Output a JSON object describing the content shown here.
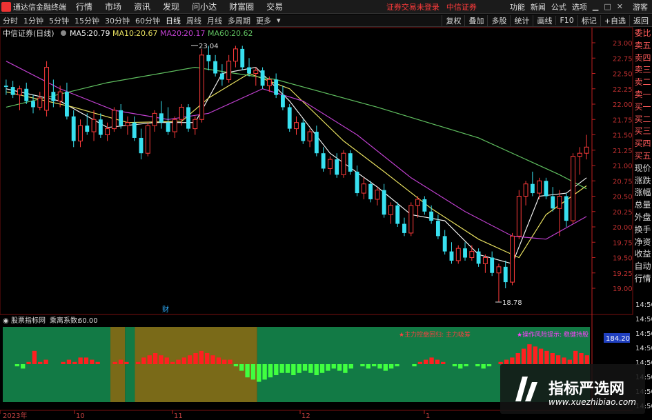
{
  "menubar": {
    "app_title": "通达信金融终端",
    "items": [
      "行情",
      "市场",
      "资讯",
      "发现",
      "问小达",
      "财富圈",
      "交易"
    ],
    "notice_left": "证券交易未登录",
    "notice_right": "中信证券",
    "right_items": [
      "功能",
      "新闻",
      "公式",
      "选项"
    ],
    "guest": "游客"
  },
  "toolbar": {
    "periods": [
      "分时",
      "1分钟",
      "5分钟",
      "15分钟",
      "30分钟",
      "60分钟",
      "日线",
      "周线",
      "月线",
      "多周期",
      "更多"
    ],
    "right_buttons": [
      "复权",
      "叠加",
      "多股",
      "统计",
      "画线",
      "F10",
      "标记",
      "+自选",
      "返回"
    ]
  },
  "chart_header": {
    "stock": "中信证券(日线)",
    "ma5_label": "MA5:",
    "ma5": "20.79",
    "ma10_label": "MA10:",
    "ma10": "20.67",
    "ma20_label": "MA20:",
    "ma20": "20.17",
    "ma60_label": "MA60:",
    "ma60": "20.62"
  },
  "colors": {
    "up": "#ff3b3b",
    "down": "#38e0f0",
    "ma5": "#f0f0f0",
    "ma10": "#e8e060",
    "ma20": "#c040d0",
    "ma60": "#60c060",
    "axis": "#c02020"
  },
  "price_axis": [
    "23.00",
    "22.75",
    "22.50",
    "22.25",
    "22.00",
    "21.75",
    "21.50",
    "21.25",
    "21.00",
    "20.75",
    "20.50",
    "20.25",
    "20.00",
    "19.75",
    "19.50",
    "19.25",
    "19.00"
  ],
  "high_annot": "23.04",
  "low_annot": "18.78",
  "news_marker": "财",
  "indicator_header": {
    "name": "股票指标网",
    "coef_label": "乘离系数:",
    "coef": "60.00"
  },
  "indicator_tags": {
    "left": "★主力控盘回归: 主力吸筹",
    "right": "★操作风险提示: 稳健持股"
  },
  "indicator_value": "184.20",
  "side_tabs": [
    "委比",
    "卖五",
    "卖四",
    "卖三",
    "卖二",
    "卖一",
    "买一",
    "买二",
    "买三",
    "买四",
    "买五",
    "现价",
    "涨跌",
    "涨幅",
    "总量",
    "外盘",
    "换手",
    "净资",
    "收益",
    "自动",
    "行情"
  ],
  "side_times": [
    "14:50",
    "14:50",
    "14:50",
    "14:50",
    "14:50",
    "14:50",
    "14:50",
    "14:50"
  ],
  "date_axis": {
    "y2023": "2023年",
    "m10": "10",
    "m11": "11",
    "m12": "12",
    "m1": "1"
  },
  "watermark": {
    "cn": "指标严选网",
    "en": "www.xuezhibiao.com"
  },
  "chart_data": {
    "type": "candlestick",
    "ylim": [
      18.78,
      23.04
    ],
    "ohlc": [
      [
        22.3,
        22.4,
        22.15,
        22.28
      ],
      [
        22.28,
        22.38,
        22.1,
        22.15
      ],
      [
        22.15,
        22.3,
        21.9,
        22.25
      ],
      [
        22.25,
        22.35,
        22.0,
        22.05
      ],
      [
        22.05,
        22.15,
        21.85,
        21.95
      ],
      [
        21.95,
        22.2,
        21.9,
        22.1
      ],
      [
        21.9,
        22.7,
        21.8,
        22.6
      ],
      [
        22.2,
        22.4,
        21.95,
        22.05
      ],
      [
        22.05,
        22.3,
        21.95,
        22.2
      ],
      [
        22.2,
        22.35,
        21.75,
        21.8
      ],
      [
        21.8,
        21.9,
        21.3,
        21.4
      ],
      [
        21.4,
        21.75,
        21.3,
        21.65
      ],
      [
        21.65,
        21.85,
        21.5,
        21.55
      ],
      [
        21.55,
        21.9,
        21.4,
        21.75
      ],
      [
        21.75,
        21.85,
        21.45,
        21.5
      ],
      [
        21.5,
        21.7,
        21.4,
        21.6
      ],
      [
        21.6,
        21.95,
        21.55,
        21.9
      ],
      [
        21.9,
        22.0,
        21.6,
        21.65
      ],
      [
        21.65,
        21.8,
        21.5,
        21.7
      ],
      [
        21.7,
        21.8,
        21.4,
        21.45
      ],
      [
        21.45,
        21.6,
        21.1,
        21.2
      ],
      [
        21.2,
        21.7,
        21.15,
        21.65
      ],
      [
        21.65,
        21.9,
        21.55,
        21.85
      ],
      [
        21.85,
        22.05,
        21.6,
        21.7
      ],
      [
        21.7,
        21.95,
        21.5,
        21.55
      ],
      [
        21.55,
        21.8,
        21.45,
        21.75
      ],
      [
        21.75,
        22.0,
        21.65,
        21.95
      ],
      [
        21.95,
        22.0,
        21.55,
        21.6
      ],
      [
        21.6,
        21.8,
        21.5,
        21.75
      ],
      [
        21.75,
        22.9,
        21.7,
        22.8
      ],
      [
        22.8,
        22.95,
        22.55,
        22.7
      ],
      [
        22.7,
        22.8,
        22.45,
        22.5
      ],
      [
        22.5,
        22.65,
        22.3,
        22.4
      ],
      [
        22.4,
        22.8,
        22.35,
        22.7
      ],
      [
        22.7,
        22.95,
        22.6,
        22.9
      ],
      [
        22.9,
        22.95,
        22.55,
        22.6
      ],
      [
        22.6,
        22.75,
        22.45,
        22.5
      ],
      [
        22.5,
        22.6,
        22.3,
        22.55
      ],
      [
        22.55,
        22.6,
        22.25,
        22.3
      ],
      [
        22.3,
        22.45,
        22.2,
        22.4
      ],
      [
        22.4,
        22.5,
        22.1,
        22.15
      ],
      [
        22.15,
        22.3,
        21.9,
        21.95
      ],
      [
        21.95,
        22.0,
        21.55,
        21.6
      ],
      [
        21.6,
        21.8,
        21.5,
        21.7
      ],
      [
        21.7,
        21.75,
        21.35,
        21.4
      ],
      [
        21.4,
        21.6,
        21.3,
        21.55
      ],
      [
        21.55,
        21.65,
        21.15,
        21.2
      ],
      [
        21.2,
        21.3,
        20.9,
        20.95
      ],
      [
        20.95,
        21.15,
        20.85,
        21.1
      ],
      [
        21.1,
        21.2,
        20.8,
        20.85
      ],
      [
        20.85,
        21.25,
        20.8,
        21.2
      ],
      [
        21.2,
        21.25,
        20.85,
        20.9
      ],
      [
        20.9,
        21.0,
        20.5,
        20.55
      ],
      [
        20.55,
        20.8,
        20.45,
        20.7
      ],
      [
        20.7,
        20.75,
        20.4,
        20.45
      ],
      [
        20.45,
        20.65,
        20.35,
        20.6
      ],
      [
        20.6,
        20.7,
        20.15,
        20.2
      ],
      [
        20.2,
        20.4,
        20.05,
        20.35
      ],
      [
        20.35,
        20.4,
        20.0,
        20.05
      ],
      [
        20.05,
        20.15,
        19.85,
        19.9
      ],
      [
        19.9,
        20.4,
        19.85,
        20.35
      ],
      [
        20.35,
        20.5,
        20.15,
        20.45
      ],
      [
        20.45,
        20.5,
        20.2,
        20.25
      ],
      [
        20.25,
        20.35,
        20.05,
        20.1
      ],
      [
        20.1,
        20.2,
        19.8,
        19.85
      ],
      [
        19.85,
        19.95,
        19.55,
        19.6
      ],
      [
        19.6,
        19.75,
        19.4,
        19.45
      ],
      [
        19.45,
        19.7,
        19.4,
        19.65
      ],
      [
        19.65,
        19.75,
        19.45,
        19.5
      ],
      [
        19.5,
        19.7,
        19.45,
        19.6
      ],
      [
        19.6,
        19.65,
        19.35,
        19.4
      ],
      [
        19.4,
        19.55,
        19.25,
        19.5
      ],
      [
        19.5,
        19.6,
        19.2,
        19.25
      ],
      [
        19.25,
        19.4,
        18.78,
        19.35
      ],
      [
        19.35,
        19.45,
        19.0,
        19.1
      ],
      [
        19.1,
        19.9,
        19.05,
        19.85
      ],
      [
        19.85,
        20.6,
        19.8,
        20.5
      ],
      [
        20.5,
        20.75,
        20.35,
        20.7
      ],
      [
        20.7,
        20.9,
        20.5,
        20.55
      ],
      [
        20.55,
        20.8,
        20.45,
        20.75
      ],
      [
        20.75,
        20.8,
        20.45,
        20.5
      ],
      [
        20.5,
        20.65,
        20.25,
        20.3
      ],
      [
        20.3,
        20.6,
        19.85,
        20.5
      ],
      [
        20.5,
        20.55,
        20.0,
        20.1
      ],
      [
        20.1,
        21.2,
        20.05,
        21.15
      ],
      [
        21.15,
        21.3,
        20.85,
        21.2
      ],
      [
        21.2,
        21.5,
        21.1,
        21.3
      ]
    ],
    "ma_series": [
      {
        "name": "MA5",
        "start": 22.25,
        "path": [
          [
            0,
            22.25
          ],
          [
            8,
            22.05
          ],
          [
            15,
            21.62
          ],
          [
            22,
            21.7
          ],
          [
            28,
            21.7
          ],
          [
            32,
            22.5
          ],
          [
            37,
            22.6
          ],
          [
            42,
            22.05
          ],
          [
            48,
            21.2
          ],
          [
            55,
            20.65
          ],
          [
            60,
            20.2
          ],
          [
            65,
            20.1
          ],
          [
            70,
            19.55
          ],
          [
            75,
            19.4
          ],
          [
            79,
            20.5
          ],
          [
            83,
            20.55
          ],
          [
            86,
            20.8
          ]
        ]
      },
      {
        "name": "MA10",
        "start": 22.2,
        "path": [
          [
            0,
            22.2
          ],
          [
            10,
            21.95
          ],
          [
            18,
            21.7
          ],
          [
            26,
            21.72
          ],
          [
            30,
            22.1
          ],
          [
            36,
            22.5
          ],
          [
            42,
            22.25
          ],
          [
            50,
            21.4
          ],
          [
            56,
            20.9
          ],
          [
            63,
            20.3
          ],
          [
            70,
            19.8
          ],
          [
            76,
            19.5
          ],
          [
            80,
            20.2
          ],
          [
            86,
            20.67
          ]
        ]
      },
      {
        "name": "MA20",
        "start": 22.7,
        "path": [
          [
            0,
            22.7
          ],
          [
            8,
            22.25
          ],
          [
            16,
            21.9
          ],
          [
            24,
            21.75
          ],
          [
            30,
            21.85
          ],
          [
            38,
            22.25
          ],
          [
            44,
            22.05
          ],
          [
            52,
            21.5
          ],
          [
            60,
            20.8
          ],
          [
            68,
            20.25
          ],
          [
            75,
            19.85
          ],
          [
            80,
            19.8
          ],
          [
            86,
            20.17
          ]
        ]
      },
      {
        "name": "MA60",
        "start": 21.95,
        "path": [
          [
            0,
            21.95
          ],
          [
            15,
            22.35
          ],
          [
            28,
            22.6
          ],
          [
            40,
            22.4
          ],
          [
            55,
            21.95
          ],
          [
            70,
            21.45
          ],
          [
            82,
            20.85
          ],
          [
            86,
            20.62
          ]
        ]
      }
    ],
    "indicator": {
      "bands": [
        [
          "green",
          0,
          22
        ],
        [
          "olive",
          22,
          25
        ],
        [
          "green",
          25,
          27
        ],
        [
          "olive",
          27,
          52
        ],
        [
          "green",
          52,
          120
        ]
      ],
      "bars": [
        0,
        0,
        -1,
        -2,
        1,
        6,
        1,
        2,
        0,
        0,
        1,
        2,
        1,
        3,
        3,
        2,
        1,
        0,
        0,
        1,
        2,
        1,
        0,
        1,
        3,
        4,
        5,
        4,
        3,
        1,
        2,
        3,
        4,
        5,
        6,
        5,
        4,
        3,
        2,
        2,
        -1,
        -3,
        -6,
        -7,
        -8,
        -7,
        -6,
        -5,
        -4,
        -4,
        -5,
        -4,
        -3,
        -4,
        -5,
        -4,
        -3,
        -2,
        -3,
        -4,
        -2,
        0,
        -1,
        -2,
        -1,
        -2,
        -3,
        -2,
        -1,
        0,
        0,
        -1,
        1,
        2,
        3,
        2,
        1,
        0,
        -1,
        -2,
        -1,
        0,
        -1,
        -2,
        -1,
        0,
        1,
        2,
        3,
        5,
        7,
        9,
        8,
        7,
        6,
        5,
        4,
        3,
        2,
        6,
        5,
        4
      ]
    }
  }
}
